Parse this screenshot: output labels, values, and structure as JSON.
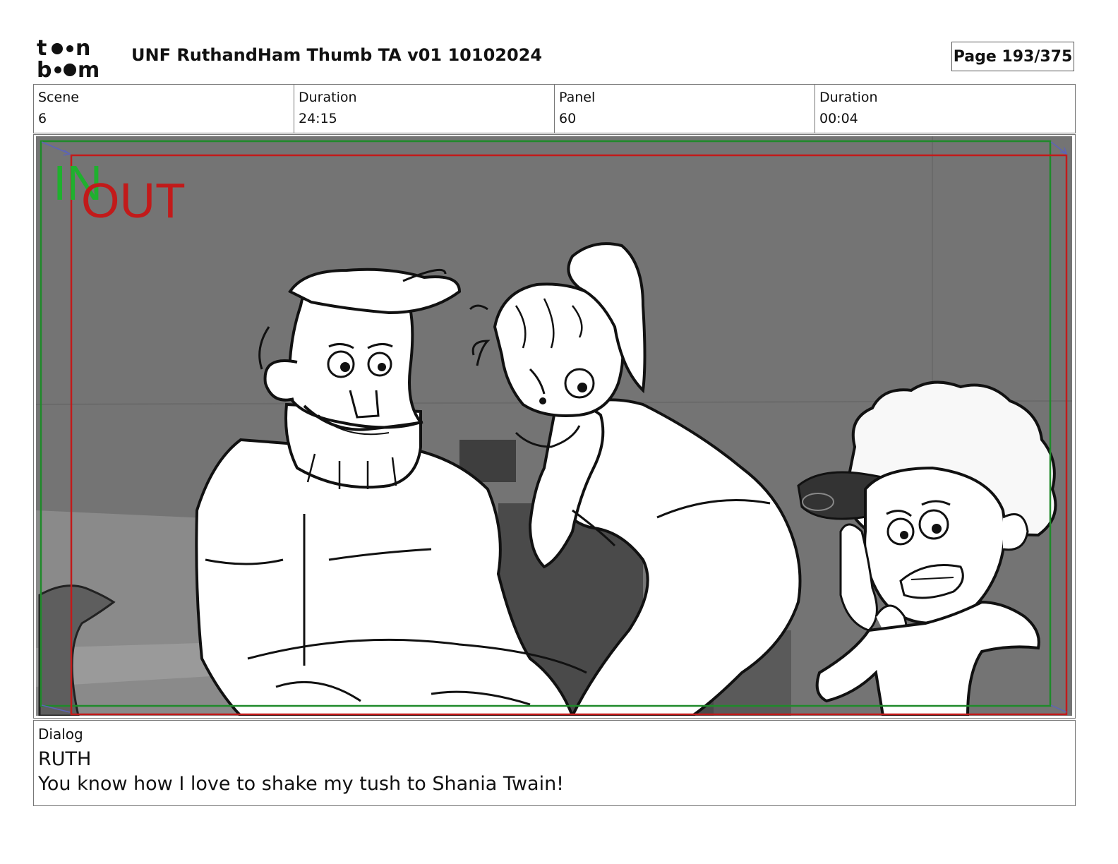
{
  "header": {
    "logo_top": "to n",
    "logo_bottom": "bo m",
    "title": "UNF RuthandHam Thumb TA v01 10102024",
    "page": "Page 193/375"
  },
  "info": {
    "scene_label": "Scene",
    "scene_value": "6",
    "scene_duration_label": "Duration",
    "scene_duration_value": "24:15",
    "panel_label": "Panel",
    "panel_value": "60",
    "panel_duration_label": "Duration",
    "panel_duration_value": "00:04"
  },
  "panel": {
    "in_label": "IN",
    "out_label": "OUT",
    "colors": {
      "in_frame": "#1f8a2a",
      "out_frame": "#c21a1a",
      "background": "#747474"
    }
  },
  "dialog": {
    "label": "Dialog",
    "character": "RUTH",
    "line": "You know how I love to shake my tush to Shania Twain!"
  }
}
